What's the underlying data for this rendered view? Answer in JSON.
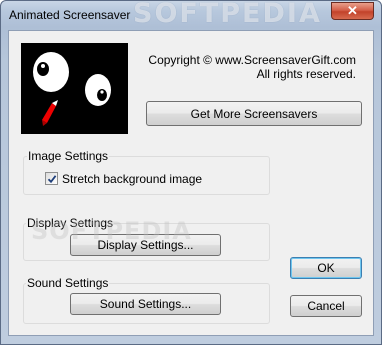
{
  "window": {
    "title": "Animated Screensaver",
    "watermark": "SOFTPEDIA",
    "close_glyph": "✕"
  },
  "header": {
    "copyright_line1": "Copyright © www.ScreensaverGift.com",
    "copyright_line2": "All rights reserved.",
    "more_button": "Get More Screensavers",
    "logo_icon": "cartoon-face-icon"
  },
  "image_settings": {
    "group_label": "Image Settings",
    "stretch_label": "Stretch background image",
    "stretch_checked": true
  },
  "display_settings": {
    "group_label": "Display Settings",
    "button_label": "Display Settings..."
  },
  "sound_settings": {
    "group_label": "Sound Settings",
    "button_label": "Sound Settings..."
  },
  "dialog": {
    "ok_label": "OK",
    "cancel_label": "Cancel"
  },
  "colors": {
    "accent": "#3c7fb1",
    "close_red": "#c2422a"
  }
}
